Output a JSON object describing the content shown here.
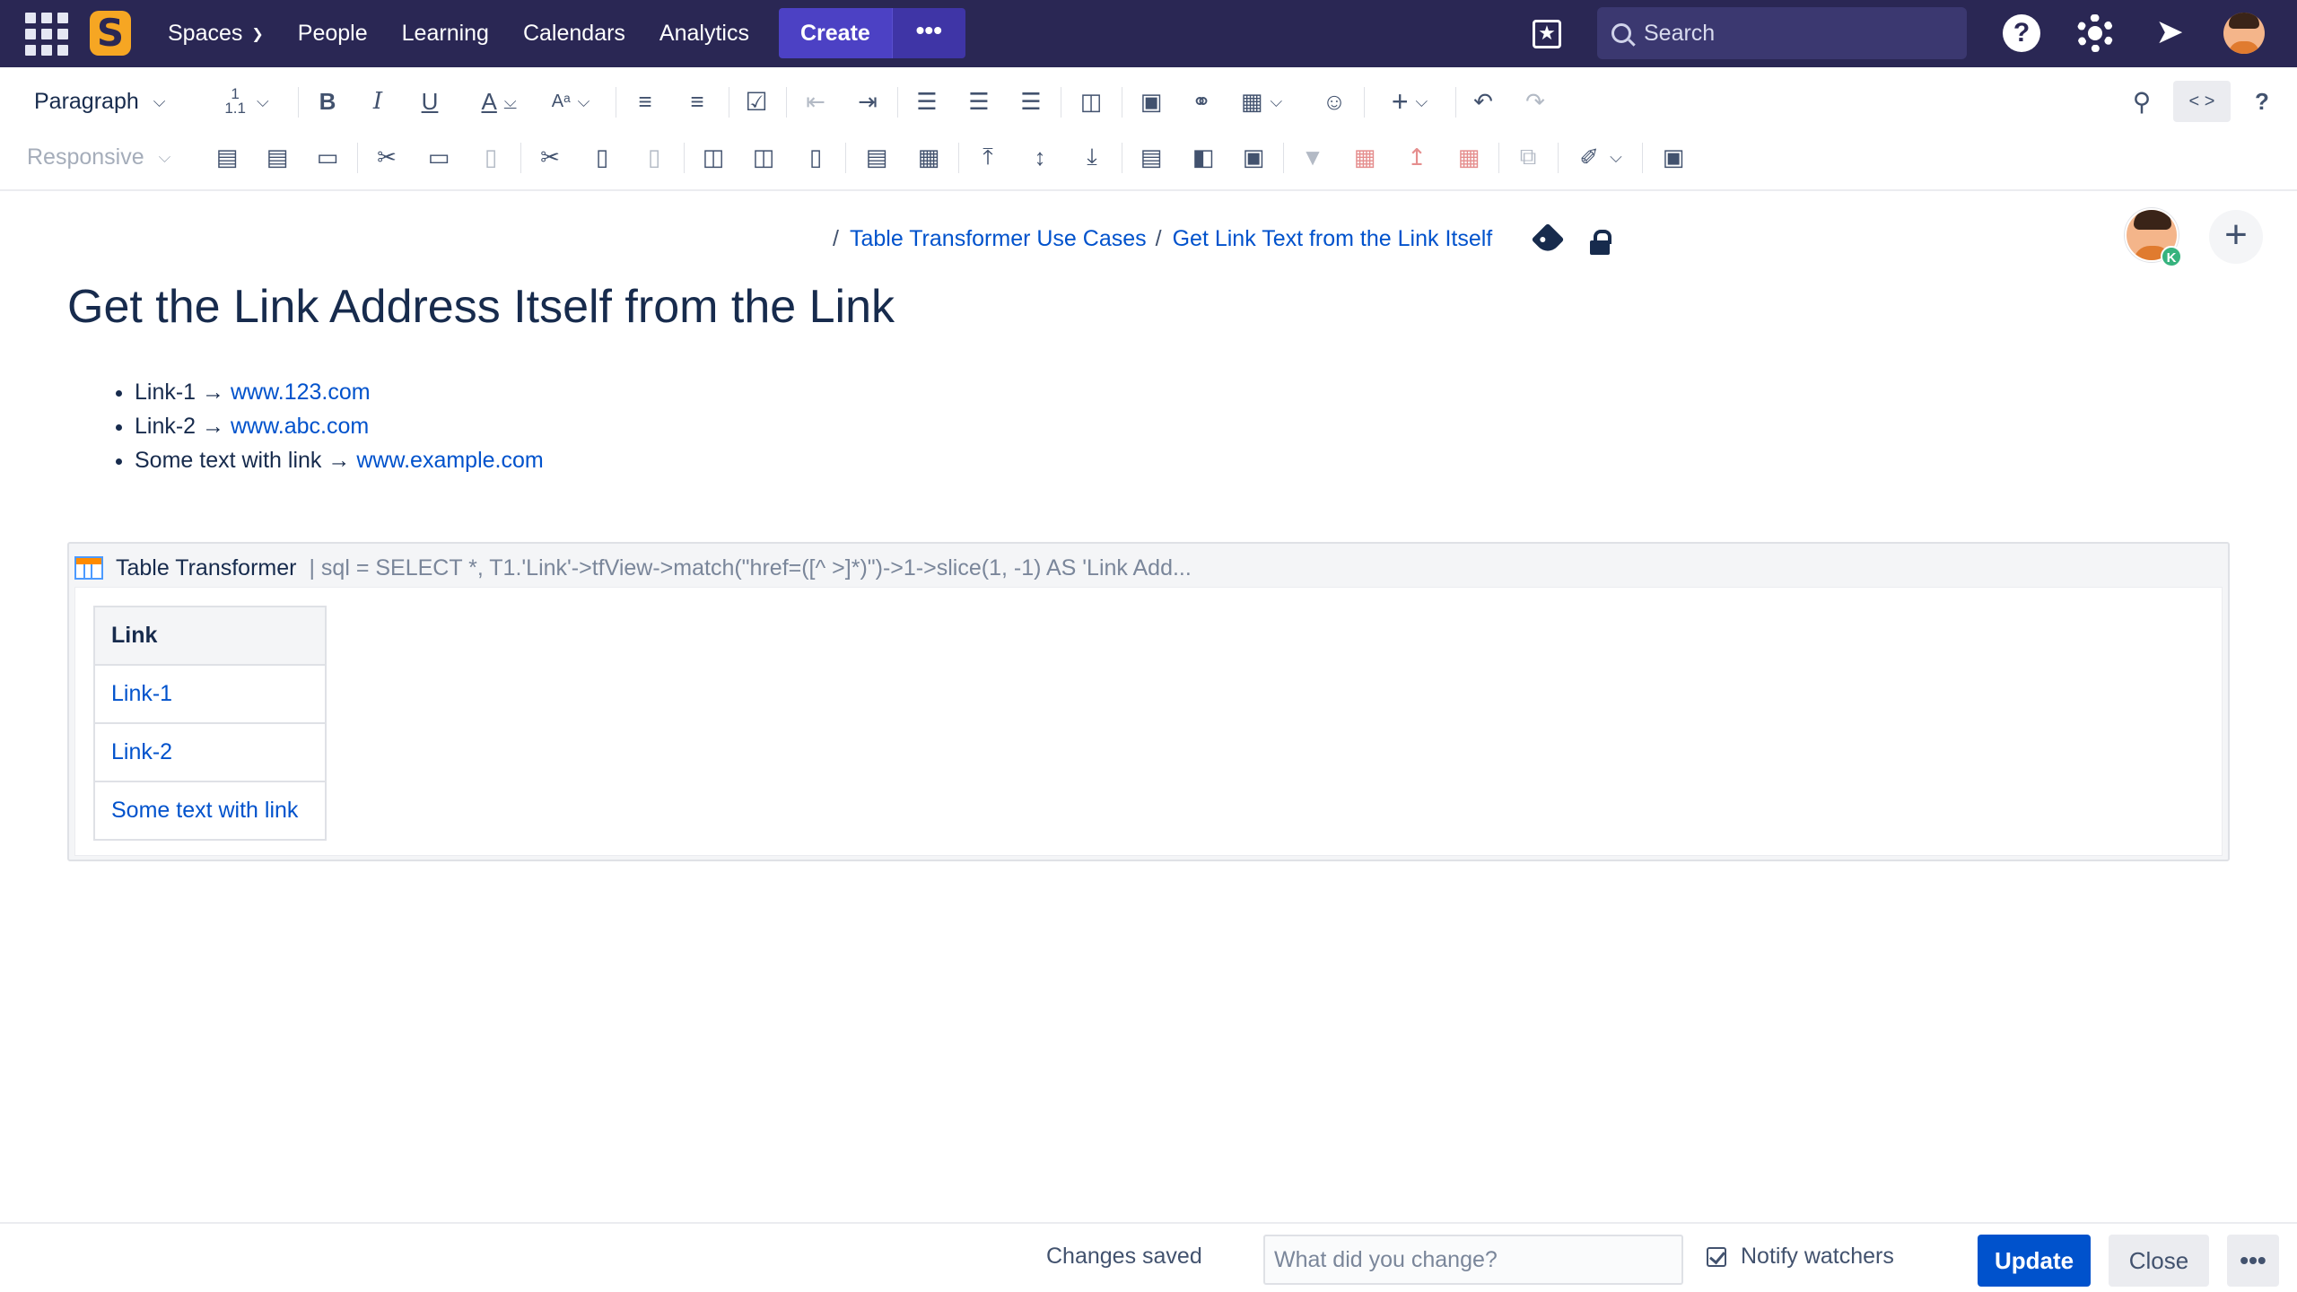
{
  "nav": {
    "logo_text": "S",
    "links": [
      {
        "label": "Spaces",
        "has_dropdown": true
      },
      {
        "label": "People"
      },
      {
        "label": "Learning"
      },
      {
        "label": "Calendars"
      },
      {
        "label": "Analytics"
      }
    ],
    "create_label": "Create",
    "more_label": "•••",
    "search_placeholder": "Search",
    "help_glyph": "?",
    "colors": {
      "nav_bg": "#2a2754",
      "create_bg": "#4c41c4",
      "accent_logo": "#f6a623"
    }
  },
  "toolbar": {
    "text_style": "Paragraph",
    "line_spacing": "1\n1.1",
    "table_layout": "Responsive",
    "source_toggle": "< >",
    "help": "?",
    "row1_icons": [
      "line-spacing-icon",
      "bold-icon",
      "italic-icon",
      "underline-icon",
      "text-color-icon",
      "text-format-icon",
      "bullet-list-icon",
      "numbered-list-icon",
      "task-list-icon",
      "outdent-icon",
      "indent-icon",
      "align-left-icon",
      "align-center-icon",
      "align-right-icon",
      "layout-icon",
      "image-icon",
      "link-icon",
      "table-icon",
      "emoji-icon",
      "insert-plus-icon",
      "undo-icon",
      "redo-icon",
      "find-replace-icon"
    ],
    "row2_icons": [
      "table-layout-icon",
      "insert-row-above-icon",
      "insert-row-below-icon",
      "delete-row-icon",
      "cut-row-icon",
      "copy-row-icon",
      "paste-row-icon",
      "cut-column-icon",
      "copy-column-icon",
      "paste-column-icon",
      "insert-column-before-icon",
      "insert-column-after-icon",
      "delete-column-icon",
      "merge-cells-icon",
      "split-cells-icon",
      "align-top-icon",
      "align-middle-icon",
      "align-bottom-icon",
      "header-row-icon",
      "header-column-icon",
      "highlight-cells-icon",
      "filter-table-icon",
      "pivot-table-icon",
      "chart-icon",
      "transform-table-icon",
      "copy-table-icon",
      "cell-color-icon",
      "remove-table-icon"
    ]
  },
  "page": {
    "breadcrumbs": [
      "Table Transformer Use Cases",
      "Get Link Text from the Link Itself"
    ],
    "collaborator_badge": "K",
    "add_collaborator": "+",
    "title": "Get the Link Address Itself from the Link",
    "bullets": [
      {
        "text": "Link-1 → ",
        "link": "www.123.com"
      },
      {
        "text": "Link-2 → ",
        "link": "www.abc.com"
      },
      {
        "text": "Some text with link → ",
        "link": "www.example.com"
      }
    ],
    "macro": {
      "name": "Table Transformer",
      "params": "| sql = SELECT *, T1.'Link'->tfView->match(\"href=([^ >]*)\")->1->slice(1, -1) AS 'Link Add...",
      "table": {
        "header": "Link",
        "rows": [
          "Link-1",
          "Link-2",
          "Some text with link"
        ]
      }
    }
  },
  "footer": {
    "status": "Changes saved",
    "change_placeholder": "What did you change?",
    "notify_label": "Notify watchers",
    "notify_checked": true,
    "update_label": "Update",
    "close_label": "Close",
    "more_label": "•••"
  }
}
